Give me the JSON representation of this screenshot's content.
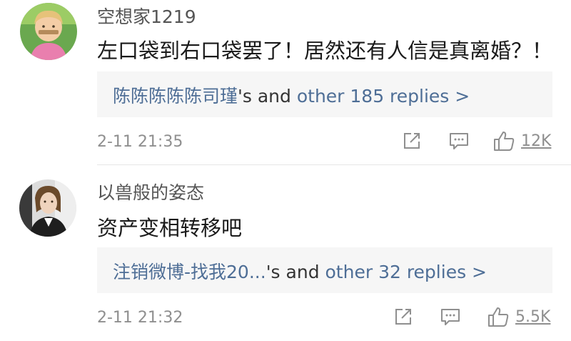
{
  "comments": [
    {
      "username": "空想家1219",
      "text": "左口袋到右口袋罢了！居然还有人信是真离婚？！",
      "reply_preview": {
        "author": "陈陈陈陈陈司瑾",
        "connector": "'s and ",
        "other_link": "other 185 replies >"
      },
      "timestamp": "2-11 21:35",
      "likes": "12K"
    },
    {
      "username": "以兽般的姿态",
      "text": "资产变相转移吧",
      "reply_preview": {
        "author": "注销微博-找我20...",
        "connector": "'s and ",
        "other_link": "other 32 replies >"
      },
      "timestamp": "2-11 21:32",
      "likes": "5.5K"
    }
  ],
  "icons": {
    "share": "share-icon",
    "reply": "comment-icon",
    "like": "thumbs-up-icon"
  },
  "colors": {
    "link": "#4e6e96",
    "meta": "#8f8f8f",
    "reply_box_bg": "#f6f6f6"
  }
}
